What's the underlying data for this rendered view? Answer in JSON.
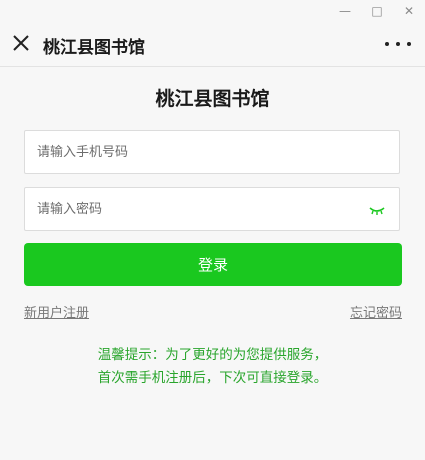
{
  "window": {
    "minimize_glyph": "—",
    "maximize_glyph": "□",
    "close_glyph": "✕"
  },
  "header": {
    "title": "桃江县图书馆"
  },
  "page": {
    "title": "桃江县图书馆"
  },
  "form": {
    "phone_placeholder": "请输入手机号码",
    "password_placeholder": "请输入密码",
    "login_label": "登录",
    "register_link": "新用户注册",
    "forgot_link": "忘记密码"
  },
  "tips": {
    "line1": "温馨提示：为了更好的为您提供服务，",
    "line2": "首次需手机注册后，下次可直接登录。"
  },
  "colors": {
    "accent": "#1ac81f",
    "tip_text": "#29a52c",
    "eye_icon": "#1ac81f"
  },
  "icons": [
    "close-icon",
    "more-icon",
    "eye-closed-icon"
  ]
}
